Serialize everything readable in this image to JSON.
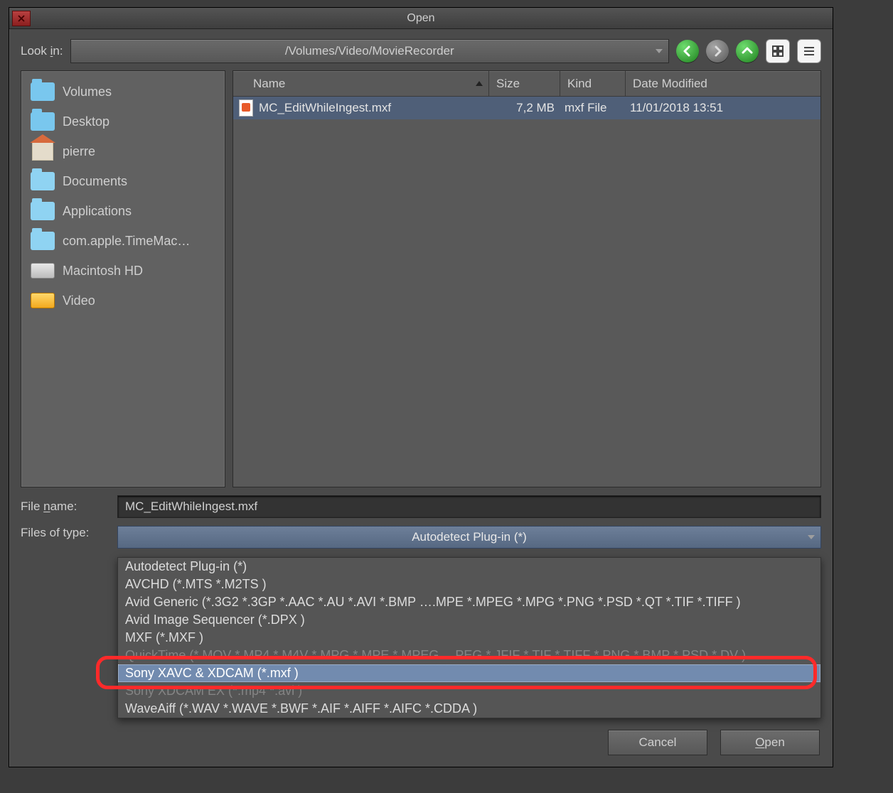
{
  "window": {
    "title": "Open"
  },
  "lookin": {
    "label_pre": "Look ",
    "label_u": "i",
    "label_post": "n:",
    "path": "/Volumes/Video/MovieRecorder"
  },
  "places": [
    {
      "name": "Volumes",
      "icon": "folder"
    },
    {
      "name": "Desktop",
      "icon": "folder"
    },
    {
      "name": "pierre",
      "icon": "home"
    },
    {
      "name": "Documents",
      "icon": "folder-dim"
    },
    {
      "name": "Applications",
      "icon": "folder-dim"
    },
    {
      "name": "com.apple.TimeMac…",
      "icon": "folder-dim"
    },
    {
      "name": "Macintosh HD",
      "icon": "hdd"
    },
    {
      "name": "Video",
      "icon": "ext"
    }
  ],
  "columns": {
    "name": "Name",
    "size": "Size",
    "kind": "Kind",
    "date": "Date Modified"
  },
  "files": [
    {
      "name": "MC_EditWhileIngest.mxf",
      "size": "7,2 MB",
      "kind": "mxf File",
      "date": "11/01/2018 13:51"
    }
  ],
  "filename": {
    "label_pre": "File ",
    "label_u": "n",
    "label_post": "ame:",
    "value": "MC_EditWhileIngest.mxf"
  },
  "filetype": {
    "label": "Files of type:",
    "selected": "Autodetect Plug-in (*)",
    "options": [
      "Autodetect Plug-in (*)",
      "AVCHD (*.MTS *.M2TS )",
      "Avid Generic (*.3G2 *.3GP *.AAC *.AU *.AVI *.BMP ….MPE *.MPEG *.MPG *.PNG *.PSD *.QT *.TIF *.TIFF )",
      "Avid Image Sequencer (*.DPX )",
      "MXF (*.MXF )",
      "QuickTime (*.MOV *.MP4 *.M4V *.MPG *.MPE *.MPEG …PEG *.JFIF *.TIF *.TIFF *.PNG *.BMP *.PSD *.DV )",
      "Sony XAVC & XDCAM (*.mxf )",
      "Sony XDCAM EX (*.mp4 *.avi )",
      "WaveAiff (*.WAV *.WAVE *.BWF *.AIF *.AIFF *.AIFC *.CDDA )"
    ],
    "selected_index": 6
  },
  "buttons": {
    "cancel": "Cancel",
    "open_pre": "",
    "open_u": "O",
    "open_post": "pen"
  }
}
